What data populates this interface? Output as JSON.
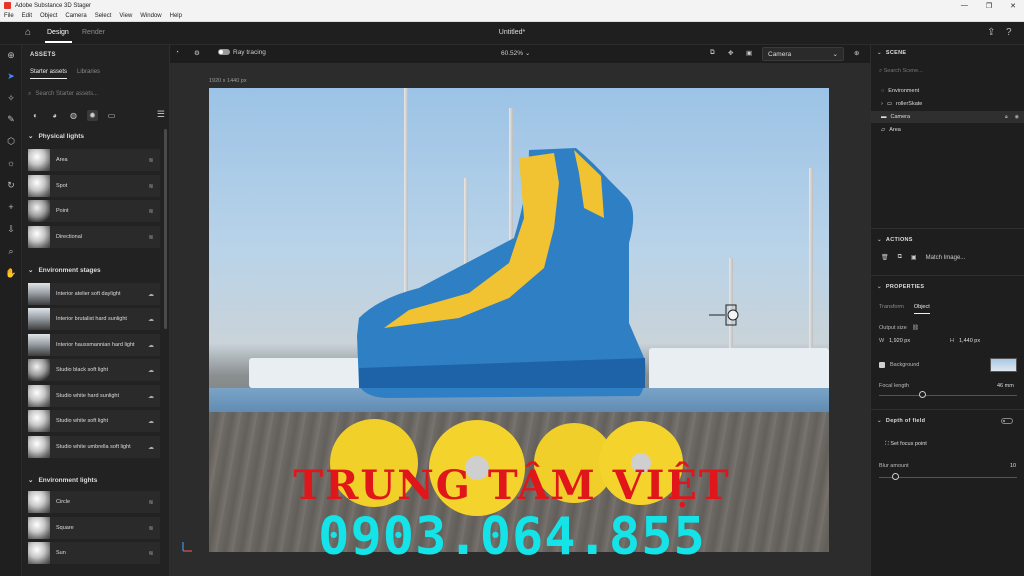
{
  "window": {
    "title": "Adobe Substance 3D Stager",
    "controls": [
      "—",
      "❐",
      "✕"
    ]
  },
  "menu": [
    "File",
    "Edit",
    "Object",
    "Camera",
    "Select",
    "View",
    "Window",
    "Help"
  ],
  "appbar": {
    "tabs": [
      "Design",
      "Render"
    ],
    "document_title": "Untitled*"
  },
  "tools": [
    "add",
    "select",
    "magic",
    "transform",
    "place",
    "light",
    "rotate",
    "plus",
    "download",
    "zoom",
    "hand"
  ],
  "assets": {
    "header": "ASSETS",
    "subtabs": [
      "Starter assets",
      "Libraries"
    ],
    "search_placeholder": "Search Starter assets...",
    "sections": [
      {
        "title": "Physical lights",
        "items": [
          "Area",
          "Spot",
          "Point",
          "Directional"
        ]
      },
      {
        "title": "Environment stages",
        "items": [
          "Interior atelier soft daylight",
          "Interior brutalist hard sunlight",
          "Interior haussmannian hard light",
          "Studio black soft light",
          "Studio white hard sunlight",
          "Studio white soft light",
          "Studio white umbrella soft light"
        ]
      },
      {
        "title": "Environment lights",
        "items": [
          "Circle",
          "Square",
          "Sun"
        ]
      }
    ]
  },
  "viewport": {
    "ray_tracing_label": "Ray tracing",
    "zoom": "60.52%",
    "camera_select": "Camera",
    "canvas_size": "1920 x 1440 px"
  },
  "watermark": {
    "line1": "TRUNG TÂM VIỆT",
    "line2": "0903.064.855",
    "line1_color": "#e0161b",
    "line2_color": "#14e3e8"
  },
  "scene": {
    "header": "SCENE",
    "search_placeholder": "Search Scene...",
    "items": [
      "Environment",
      "rollerSkate",
      "Camera",
      "Area"
    ]
  },
  "actions": {
    "header": "ACTIONS",
    "match_image": "Match Image..."
  },
  "properties": {
    "header": "PROPERTIES",
    "tabs": [
      "Transform",
      "Object"
    ],
    "output_size_label": "Output size",
    "w_label": "W",
    "w_value": "1,920 px",
    "h_label": "H",
    "h_value": "1,440 px",
    "background_label": "Background",
    "focal_length_label": "Focal length",
    "focal_length_value": "46 mm",
    "depth_of_field": "Depth of field",
    "set_focus_point": "Set focus point",
    "blur_amount_label": "Blur amount",
    "blur_amount_value": "10"
  }
}
